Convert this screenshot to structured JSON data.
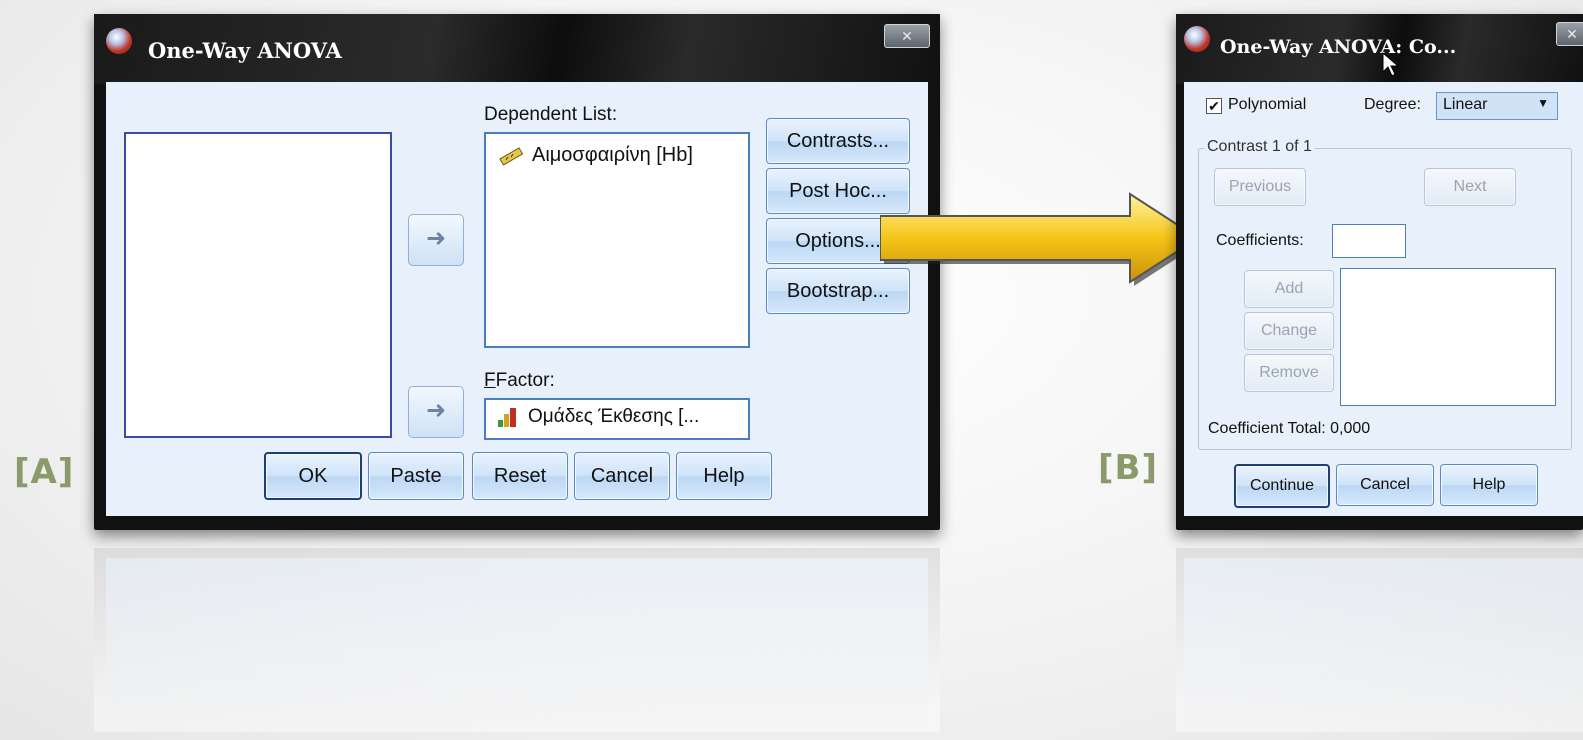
{
  "labels": {
    "a": "[A]",
    "b": "[B]"
  },
  "dialog_a": {
    "title": "One-Way ANOVA",
    "dependent_list_label": "Dependent List:",
    "dependent_item": "Αιμοσφαιρίνη [Hb]",
    "factor_label": "Factor:",
    "factor_item": "Ομάδες Έκθεσης [...",
    "side_buttons": {
      "contrasts": "Contrasts...",
      "post_hoc": "Post Hoc...",
      "options": "Options...",
      "bootstrap": "Bootstrap..."
    },
    "bottom_buttons": {
      "ok": "OK",
      "paste": "Paste",
      "reset": "Reset",
      "cancel": "Cancel",
      "help": "Help"
    }
  },
  "dialog_b": {
    "title": "One-Way ANOVA: Co...",
    "polynomial_label": "Polynomial",
    "polynomial_checked": true,
    "degree_label": "Degree:",
    "degree_value": "Linear",
    "contrast_group_label": "Contrast 1 of 1",
    "previous": "Previous",
    "next": "Next",
    "coefficients_label": "Coefficients:",
    "coefficients_value": "",
    "add": "Add",
    "change": "Change",
    "remove": "Remove",
    "coefficient_total_label": "Coefficient Total:",
    "coefficient_total_value": "0,000",
    "buttons": {
      "continue": "Continue",
      "cancel": "Cancel",
      "help": "Help"
    }
  },
  "colors": {
    "arrow": "#f0c419",
    "accent_border": "#4a7fbf",
    "label_tag": "#8a9a6a"
  }
}
